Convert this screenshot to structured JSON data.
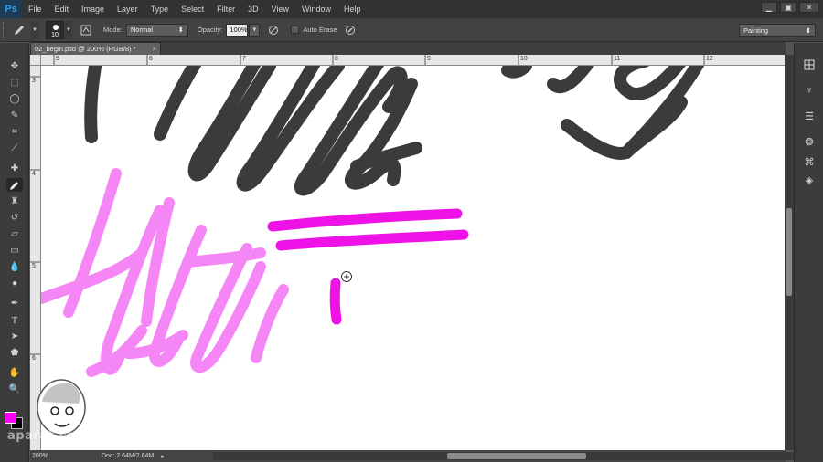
{
  "app": {
    "logo": "Ps"
  },
  "menu": [
    "File",
    "Edit",
    "Image",
    "Layer",
    "Type",
    "Select",
    "Filter",
    "3D",
    "View",
    "Window",
    "Help"
  ],
  "window_controls": {
    "minimize": "▁",
    "maximize": "▣",
    "close": "✕"
  },
  "options": {
    "brush_size": "10",
    "mode_label": "Mode:",
    "mode_value": "Normal",
    "opacity_label": "Opacity:",
    "opacity_value": "100%",
    "auto_erase_label": "Auto Erase",
    "workspace": "Painting"
  },
  "document": {
    "tab_title": "02_begin.psd @ 200% (RGB/8) *",
    "tab_close": "×",
    "zoom": "200%",
    "doc_size": "Doc: 2.64M/2.64M"
  },
  "rulers": {
    "horizontal": [
      "5",
      "6",
      "7",
      "8",
      "9",
      "10",
      "11",
      "12"
    ],
    "vertical": [
      "3",
      "4",
      "5",
      "6"
    ]
  },
  "colors": {
    "foreground": "#ff00ff",
    "background": "#000000",
    "dark_stroke": "#3b3b3b",
    "pink_stroke": "#f57af5",
    "magenta_stroke": "#ee12e6"
  },
  "tools": [
    "move-icon",
    "marquee-icon",
    "lasso-icon",
    "quick-select-icon",
    "crop-icon",
    "eyedropper-icon",
    "healing-icon",
    "pencil-icon",
    "stamp-icon",
    "history-brush-icon",
    "eraser-icon",
    "gradient-icon",
    "blur-icon",
    "dodge-icon",
    "pen-icon",
    "type-icon",
    "path-select-icon",
    "shape-icon",
    "hand-icon",
    "zoom-icon"
  ],
  "watermark": "aparat.com"
}
